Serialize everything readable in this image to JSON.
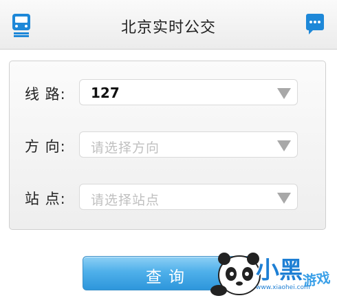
{
  "header": {
    "title": "北京实时公交",
    "left_icon": "train-icon",
    "right_icon": "chat-icon"
  },
  "form": {
    "rows": [
      {
        "label": "线 路:",
        "value": "127",
        "placeholder": ""
      },
      {
        "label": "方 向:",
        "value": "",
        "placeholder": "请选择方向"
      },
      {
        "label": "站 点:",
        "value": "",
        "placeholder": "请选择站点"
      }
    ]
  },
  "query_button": {
    "label": "查询"
  },
  "watermark": {
    "title": "小黑",
    "subtitle": "游戏",
    "url": "www.xiaohei.com"
  },
  "colors": {
    "accent": "#1e88d8",
    "button_top": "#8ed0f5",
    "button_bottom": "#2d96db",
    "placeholder": "#c0c0c0"
  }
}
